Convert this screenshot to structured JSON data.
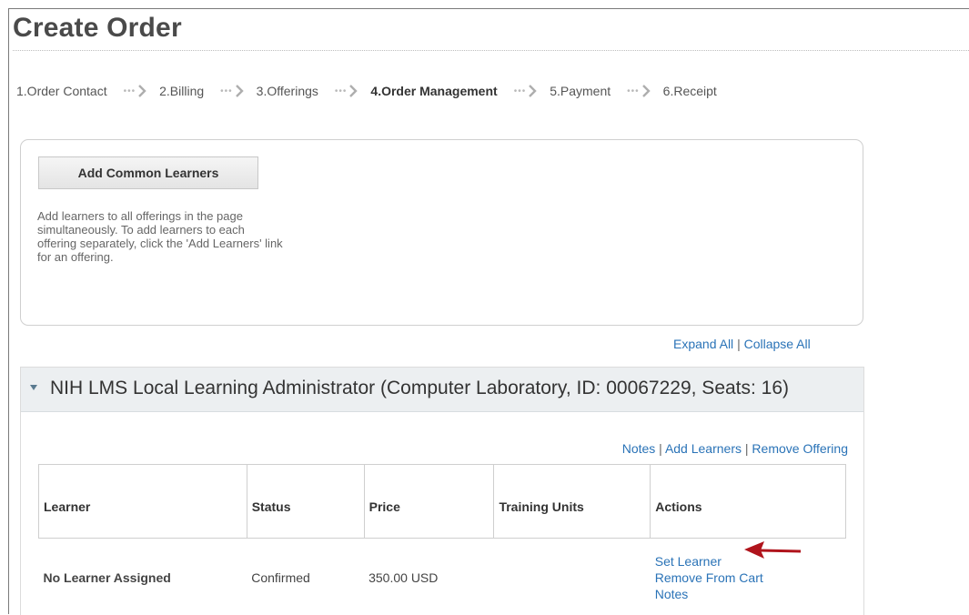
{
  "page": {
    "title": "Create Order"
  },
  "steps": [
    {
      "label": "1.Order Contact",
      "active": false
    },
    {
      "label": "2.Billing",
      "active": false
    },
    {
      "label": "3.Offerings",
      "active": false
    },
    {
      "label": "4.Order Management",
      "active": true
    },
    {
      "label": "5.Payment",
      "active": false
    },
    {
      "label": "6.Receipt",
      "active": false
    }
  ],
  "common_learners": {
    "button_label": "Add Common Learners",
    "help_text": "Add learners to all offerings in the page simultaneously. To add learners to each offering separately, click the 'Add Learners' link for an offering."
  },
  "toggle_links": {
    "expand_all": "Expand All",
    "separator": "|",
    "collapse_all": "Collapse All"
  },
  "offering": {
    "title": "NIH LMS Local Learning Administrator (Computer Laboratory, ID: 00067229, Seats: 16)",
    "links": {
      "notes": "Notes",
      "add_learners": "Add Learners",
      "remove_offering": "Remove Offering",
      "separator": "|"
    },
    "table": {
      "headers": [
        "Learner",
        "Status",
        "Price",
        "Training Units",
        "Actions"
      ],
      "rows": [
        {
          "learner": "No Learner Assigned",
          "status": "Confirmed",
          "price": "350.00 USD",
          "training_units": "",
          "actions": [
            "Set Learner",
            "Remove From Cart",
            "Notes"
          ]
        }
      ]
    }
  },
  "colors": {
    "link": "#2a73b7",
    "header_bg": "#eceff1",
    "annotation_arrow": "#b0141c"
  },
  "icons": {
    "step_separator": "step-arrow-icon",
    "collapse_toggle": "caret-down-icon",
    "annotation": "red-arrow-icon"
  }
}
